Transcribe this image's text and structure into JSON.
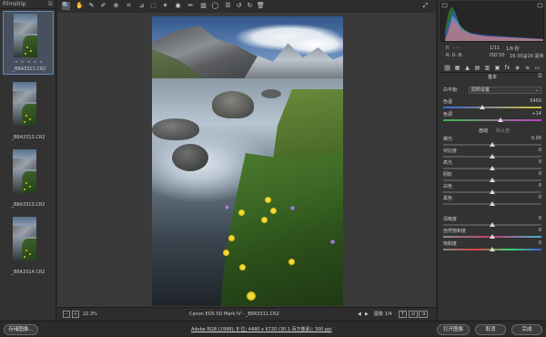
{
  "filmstrip": {
    "title": "Filmstrip",
    "menu_icon": "hamburger-icon",
    "items": [
      {
        "name": "_B8A3311.CR2",
        "stars": "★ ★ ★ ★ ★",
        "selected": true
      },
      {
        "name": "_B8A3312.CR2",
        "stars": "",
        "selected": false
      },
      {
        "name": "_B8A3313.CR2",
        "stars": "",
        "selected": false
      },
      {
        "name": "_B8A3314.CR2",
        "stars": "",
        "selected": false
      }
    ]
  },
  "toolbar": {
    "tools": [
      {
        "name": "zoom-tool-icon",
        "glyph": "🔍",
        "active": true
      },
      {
        "name": "hand-tool-icon",
        "glyph": "✋"
      },
      {
        "name": "white-balance-tool-icon",
        "glyph": "✎"
      },
      {
        "name": "color-sampler-tool-icon",
        "glyph": "✐"
      },
      {
        "name": "targeted-adjustment-tool-icon",
        "glyph": "⊕"
      },
      {
        "name": "crop-tool-icon",
        "glyph": "⌗"
      },
      {
        "name": "straighten-tool-icon",
        "glyph": "⊿"
      },
      {
        "name": "transform-tool-icon",
        "glyph": "⬚"
      },
      {
        "name": "spot-removal-tool-icon",
        "glyph": "✶"
      },
      {
        "name": "red-eye-tool-icon",
        "glyph": "◉"
      },
      {
        "name": "adjustment-brush-icon",
        "glyph": "✏"
      },
      {
        "name": "graduated-filter-icon",
        "glyph": "▥"
      },
      {
        "name": "radial-filter-icon",
        "glyph": "◯"
      },
      {
        "name": "preferences-icon",
        "glyph": "☰"
      },
      {
        "name": "rotate-left-icon",
        "glyph": "↺"
      },
      {
        "name": "rotate-right-icon",
        "glyph": "↻"
      },
      {
        "name": "trash-icon",
        "glyph": "🗑"
      }
    ],
    "fullscreen_icon": "fullscreen-icon"
  },
  "canvas_bottom": {
    "zoom": "22.3%",
    "filename": "Canon EOS 5D Mark IV  -  _B8A3311.CR2",
    "image_counter": "图像 1/4",
    "nav_prev": "◀",
    "nav_next": "▶"
  },
  "meta": {
    "f_label": "f/",
    "f_val": "- - -",
    "iso_label": "ISO 50",
    "shutter": "1/11",
    "time": "1/6 秒",
    "lens": "16-35@16 毫米"
  },
  "panel": {
    "title": "基本",
    "wb_label": "白平衡:",
    "wb_value": "原照设置",
    "sliders": [
      {
        "name": "temperature",
        "label": "色温",
        "value": "5450",
        "pct": 0.4,
        "track": "temp"
      },
      {
        "name": "tint",
        "label": "色调",
        "value": "+14",
        "pct": 0.58,
        "track": "tint"
      },
      {
        "name": "exposure",
        "label": "曝光",
        "value": "0.00",
        "pct": 0.5
      },
      {
        "name": "contrast",
        "label": "对比度",
        "value": "0",
        "pct": 0.5
      },
      {
        "name": "highlights",
        "label": "高光",
        "value": "0",
        "pct": 0.5
      },
      {
        "name": "shadows",
        "label": "阴影",
        "value": "0",
        "pct": 0.5
      },
      {
        "name": "whites",
        "label": "白色",
        "value": "0",
        "pct": 0.5
      },
      {
        "name": "blacks",
        "label": "黑色",
        "value": "0",
        "pct": 0.5
      },
      {
        "name": "clarity",
        "label": "清晰度",
        "value": "0",
        "pct": 0.5
      },
      {
        "name": "vibrance",
        "label": "自然饱和度",
        "value": "0",
        "pct": 0.5,
        "track": "vib"
      },
      {
        "name": "saturation",
        "label": "饱和度",
        "value": "0",
        "pct": 0.5,
        "track": "sat"
      }
    ],
    "auto_label": "自动",
    "default_label": "默认值"
  },
  "footer": {
    "save_label": "存储图像...",
    "workflow_link": "Adobe RGB (1998); 8 位; 4480 x 6720 (30.1 百万像素); 300 ppi",
    "open_label": "打开图像",
    "cancel_label": "取消",
    "done_label": "完成"
  }
}
